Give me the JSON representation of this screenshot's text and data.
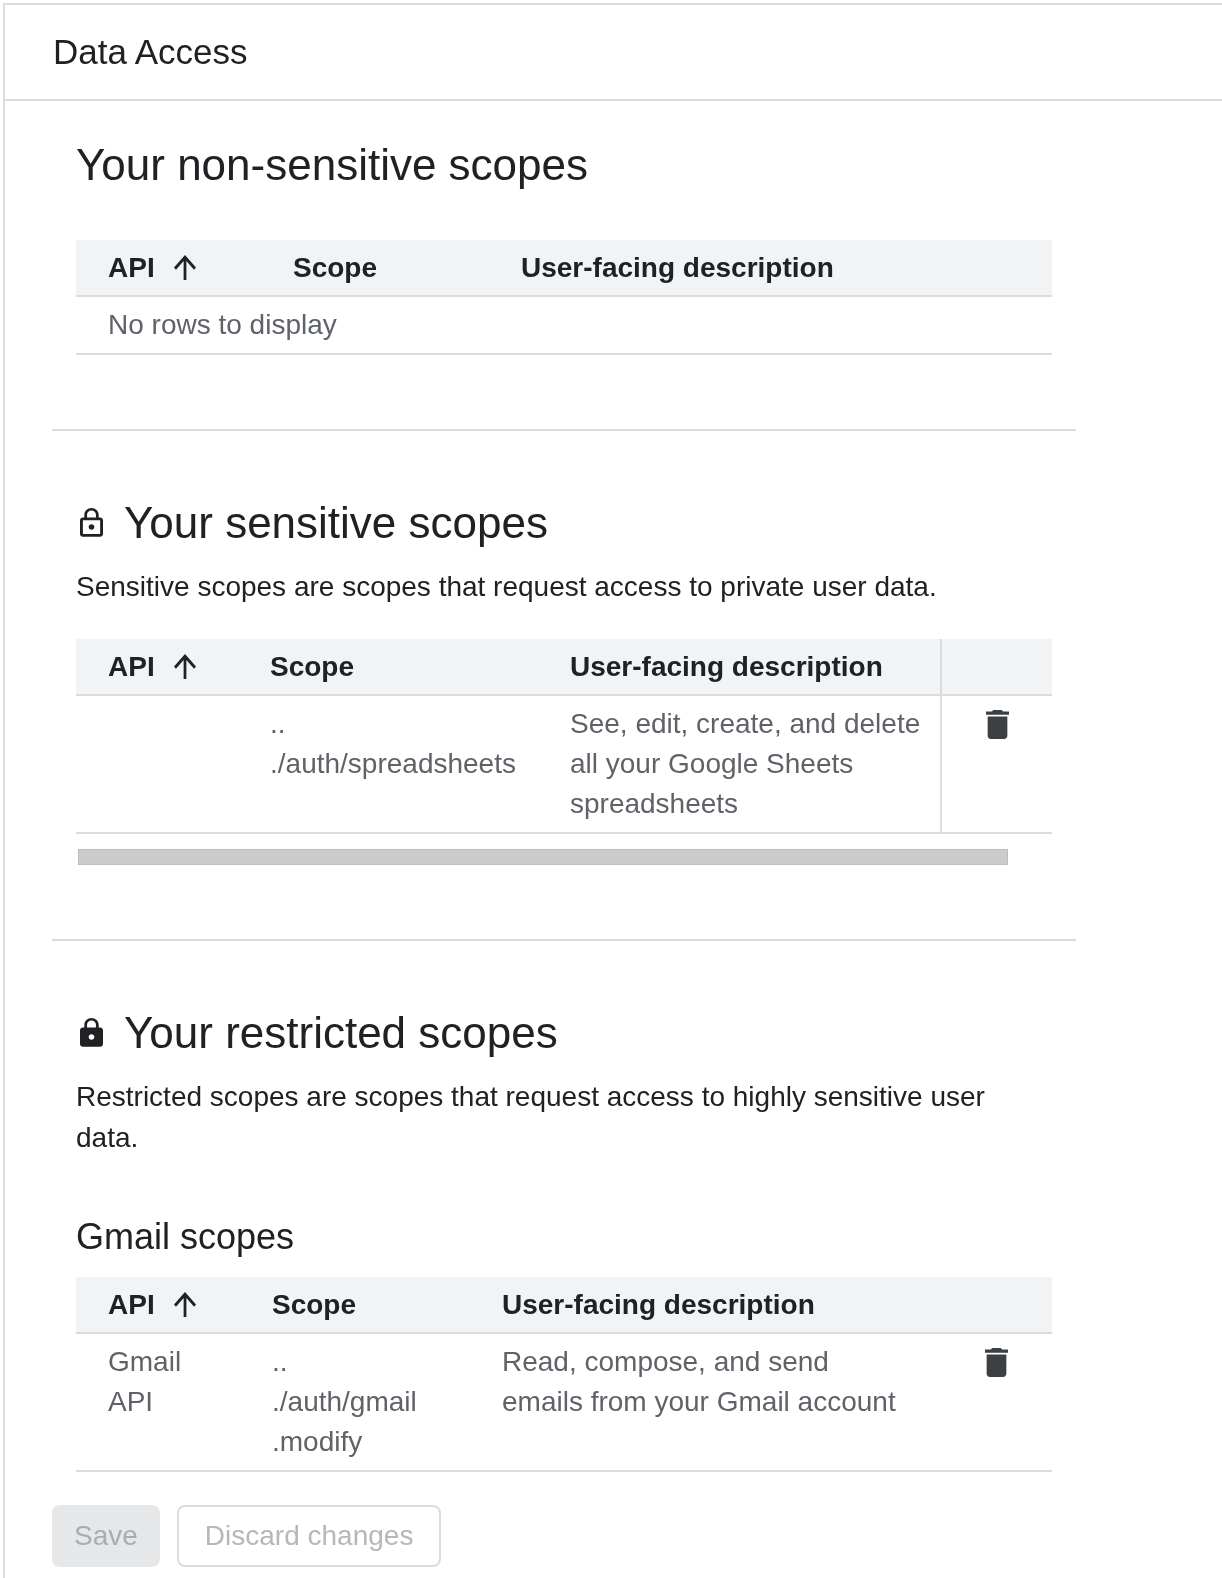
{
  "page": {
    "title": "Data Access"
  },
  "sections": [
    {
      "kind": "non_sensitive",
      "title": "Your non-sensitive scopes",
      "table": {
        "columns": [
          {
            "label": "API",
            "sorted": true
          },
          {
            "label": "Scope",
            "sorted": false
          },
          {
            "label": "User-facing description",
            "sorted": false
          }
        ],
        "horizontal_scroll": false,
        "empty_message": "No rows to display"
      }
    },
    {
      "kind": "sensitive",
      "title": "Your sensitive scopes",
      "description": "Sensitive scopes are scopes that request access to private user data.",
      "table": {
        "columns": [
          {
            "label": "API",
            "sorted": true
          },
          {
            "label": "Scope",
            "sorted": false
          },
          {
            "label": "User-facing description",
            "sorted": false
          }
        ],
        "horizontal_scroll": true,
        "rows": [
          {
            "scope": ".../auth/spreadsheets",
            "description": "See, edit, create, and delete all your Google Sheets spreadsheets"
          }
        ]
      }
    },
    {
      "kind": "restricted",
      "title": "Your restricted scopes",
      "description": "Restricted scopes are scopes that request access to highly sensitive user data.",
      "table": {
        "title": "Gmail scopes",
        "columns": [
          {
            "label": "API",
            "sorted": true
          },
          {
            "label": "Scope",
            "sorted": false
          },
          {
            "label": "User-facing description",
            "sorted": false
          }
        ],
        "horizontal_scroll": false,
        "rows": [
          {
            "api": "Gmail API",
            "scope": ".../auth/gmail.modify",
            "description": "Read, compose, and send emails from your Gmail account"
          }
        ]
      }
    }
  ],
  "buttons": [
    {
      "kind": "filled",
      "label": "Save",
      "disabled": true
    },
    {
      "kind": "outlined",
      "label": "Discard changes",
      "disabled": true
    }
  ]
}
